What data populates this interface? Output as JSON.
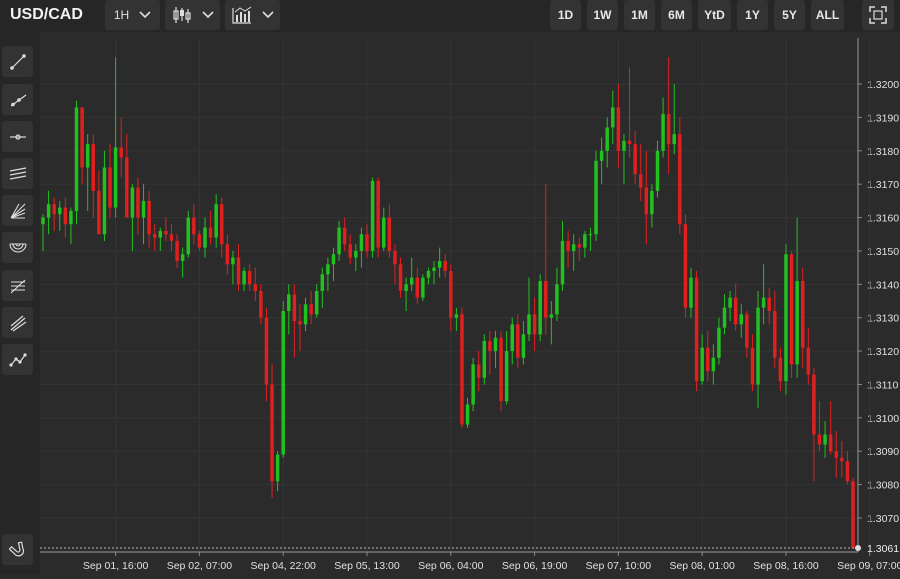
{
  "header": {
    "symbol": "USD/CAD",
    "interval": "1H",
    "ranges": [
      "1D",
      "1W",
      "1M",
      "6M",
      "YtD",
      "1Y",
      "5Y",
      "ALL"
    ]
  },
  "icons": {
    "chart_type": "candlestick-icon",
    "indicators": "indicators-icon",
    "fullscreen": "fullscreen-icon",
    "tools": [
      "trend-line-icon",
      "ray-line-icon",
      "horizontal-line-icon",
      "parallel-channel-icon",
      "fib-fan-icon",
      "fib-arc-icon",
      "fib-retracement-icon",
      "pitchfork-icon",
      "polyline-icon",
      "magnet-icon"
    ]
  },
  "colors": {
    "up": "#21c21f",
    "down": "#e0201f",
    "background": "#2b2b2b",
    "grid": "#353535"
  },
  "chart_data": {
    "type": "candlestick",
    "ylim": [
      1.3061,
      1.3212
    ],
    "y_ticks": [
      "1.3200",
      "1.3190",
      "1.3180",
      "1.3170",
      "1.3160",
      "1.3150",
      "1.3140",
      "1.3130",
      "1.3120",
      "1.3110",
      "1.3100",
      "1.3090",
      "1.3080",
      "1.3070"
    ],
    "current_price": "1.3061",
    "x_ticks": [
      {
        "label": "Sep 01, 16:00",
        "index": 13
      },
      {
        "label": "Sep 02, 07:00",
        "index": 28
      },
      {
        "label": "Sep 04, 22:00",
        "index": 43
      },
      {
        "label": "Sep 05, 13:00",
        "index": 58
      },
      {
        "label": "Sep 06, 04:00",
        "index": 73
      },
      {
        "label": "Sep 06, 19:00",
        "index": 88
      },
      {
        "label": "Sep 07, 10:00",
        "index": 103
      },
      {
        "label": "Sep 08, 01:00",
        "index": 118
      },
      {
        "label": "Sep 08, 16:00",
        "index": 133
      },
      {
        "label": "Sep 09, 07:00",
        "index": 148
      }
    ],
    "candles": [
      [
        1.3158,
        1.3161,
        1.315,
        1.316
      ],
      [
        1.316,
        1.3168,
        1.3155,
        1.3164
      ],
      [
        1.3164,
        1.3166,
        1.3156,
        1.3161
      ],
      [
        1.3161,
        1.3165,
        1.3156,
        1.3163
      ],
      [
        1.3163,
        1.3166,
        1.3154,
        1.3158
      ],
      [
        1.3158,
        1.3163,
        1.3152,
        1.3162
      ],
      [
        1.3162,
        1.3195,
        1.3158,
        1.3193
      ],
      [
        1.3193,
        1.3193,
        1.317,
        1.3175
      ],
      [
        1.3175,
        1.3185,
        1.3162,
        1.3182
      ],
      [
        1.3182,
        1.3185,
        1.316,
        1.3168
      ],
      [
        1.3168,
        1.3174,
        1.3155,
        1.3155
      ],
      [
        1.3155,
        1.318,
        1.3153,
        1.3175
      ],
      [
        1.3175,
        1.3182,
        1.316,
        1.3163
      ],
      [
        1.3163,
        1.3208,
        1.316,
        1.3181
      ],
      [
        1.3181,
        1.319,
        1.3172,
        1.3178
      ],
      [
        1.3178,
        1.3185,
        1.3165,
        1.316
      ],
      [
        1.316,
        1.317,
        1.315,
        1.3169
      ],
      [
        1.3169,
        1.3172,
        1.3155,
        1.316
      ],
      [
        1.316,
        1.317,
        1.3152,
        1.3165
      ],
      [
        1.3165,
        1.3168,
        1.3151,
        1.3155
      ],
      [
        1.3155,
        1.3158,
        1.315,
        1.3154
      ],
      [
        1.3154,
        1.3157,
        1.315,
        1.3156
      ],
      [
        1.3156,
        1.316,
        1.3153,
        1.3155
      ],
      [
        1.3155,
        1.3158,
        1.315,
        1.3153
      ],
      [
        1.3153,
        1.3155,
        1.3145,
        1.3147
      ],
      [
        1.3147,
        1.3151,
        1.3142,
        1.3149
      ],
      [
        1.3149,
        1.3162,
        1.3148,
        1.316
      ],
      [
        1.316,
        1.3164,
        1.3152,
        1.3155
      ],
      [
        1.3155,
        1.3156,
        1.315,
        1.3151
      ],
      [
        1.3151,
        1.316,
        1.3148,
        1.3157
      ],
      [
        1.3157,
        1.3162,
        1.3152,
        1.3154
      ],
      [
        1.3154,
        1.3167,
        1.3151,
        1.3164
      ],
      [
        1.3164,
        1.3166,
        1.3148,
        1.3152
      ],
      [
        1.3152,
        1.3155,
        1.3143,
        1.3146
      ],
      [
        1.3146,
        1.315,
        1.314,
        1.3148
      ],
      [
        1.3148,
        1.3152,
        1.3138,
        1.314
      ],
      [
        1.314,
        1.3145,
        1.3138,
        1.3144
      ],
      [
        1.3144,
        1.3146,
        1.3138,
        1.314
      ],
      [
        1.314,
        1.3145,
        1.3135,
        1.3138
      ],
      [
        1.3138,
        1.314,
        1.3128,
        1.313
      ],
      [
        1.313,
        1.3133,
        1.3105,
        1.311
      ],
      [
        1.311,
        1.3116,
        1.3076,
        1.3081
      ],
      [
        1.3081,
        1.309,
        1.3078,
        1.3089
      ],
      [
        1.3089,
        1.3135,
        1.3088,
        1.3132
      ],
      [
        1.3132,
        1.314,
        1.3125,
        1.3137
      ],
      [
        1.3137,
        1.314,
        1.3118,
        1.3129
      ],
      [
        1.3129,
        1.3134,
        1.312,
        1.3128
      ],
      [
        1.3128,
        1.3136,
        1.3126,
        1.3134
      ],
      [
        1.3134,
        1.3138,
        1.3128,
        1.3131
      ],
      [
        1.3131,
        1.314,
        1.313,
        1.3138
      ],
      [
        1.3138,
        1.3145,
        1.3133,
        1.3143
      ],
      [
        1.3143,
        1.3148,
        1.3138,
        1.3146
      ],
      [
        1.3146,
        1.3151,
        1.3141,
        1.3149
      ],
      [
        1.3149,
        1.3159,
        1.3147,
        1.3157
      ],
      [
        1.3157,
        1.316,
        1.315,
        1.3152
      ],
      [
        1.3152,
        1.3155,
        1.3146,
        1.3148
      ],
      [
        1.3148,
        1.3152,
        1.3144,
        1.315
      ],
      [
        1.315,
        1.3157,
        1.3145,
        1.3155
      ],
      [
        1.3155,
        1.3158,
        1.3148,
        1.315
      ],
      [
        1.315,
        1.3172,
        1.3148,
        1.3171
      ],
      [
        1.3171,
        1.3172,
        1.3148,
        1.3151
      ],
      [
        1.3151,
        1.3163,
        1.315,
        1.316
      ],
      [
        1.316,
        1.3164,
        1.3148,
        1.315
      ],
      [
        1.315,
        1.3152,
        1.314,
        1.3146
      ],
      [
        1.3146,
        1.3148,
        1.3136,
        1.3138
      ],
      [
        1.3138,
        1.3142,
        1.3132,
        1.314
      ],
      [
        1.314,
        1.3148,
        1.3138,
        1.3142
      ],
      [
        1.3142,
        1.3145,
        1.3134,
        1.3136
      ],
      [
        1.3136,
        1.3143,
        1.3135,
        1.3142
      ],
      [
        1.3142,
        1.3145,
        1.314,
        1.3144
      ],
      [
        1.3144,
        1.3147,
        1.314,
        1.3145
      ],
      [
        1.3145,
        1.3151,
        1.3142,
        1.3147
      ],
      [
        1.3147,
        1.3149,
        1.3142,
        1.3144
      ],
      [
        1.3144,
        1.3146,
        1.3126,
        1.313
      ],
      [
        1.313,
        1.3133,
        1.3126,
        1.3131
      ],
      [
        1.3131,
        1.3133,
        1.3097,
        1.3098
      ],
      [
        1.3098,
        1.3106,
        1.3097,
        1.3104
      ],
      [
        1.3104,
        1.3118,
        1.3102,
        1.3116
      ],
      [
        1.3116,
        1.312,
        1.3108,
        1.3112
      ],
      [
        1.3112,
        1.3125,
        1.311,
        1.3123
      ],
      [
        1.3123,
        1.3126,
        1.3113,
        1.312
      ],
      [
        1.312,
        1.3126,
        1.3115,
        1.3124
      ],
      [
        1.3124,
        1.3126,
        1.3102,
        1.3105
      ],
      [
        1.3105,
        1.3126,
        1.3104,
        1.312
      ],
      [
        1.312,
        1.313,
        1.3116,
        1.3128
      ],
      [
        1.3128,
        1.3131,
        1.3115,
        1.3118
      ],
      [
        1.3118,
        1.3129,
        1.3116,
        1.3125
      ],
      [
        1.3125,
        1.3142,
        1.3123,
        1.3131
      ],
      [
        1.3131,
        1.3136,
        1.312,
        1.3125
      ],
      [
        1.3125,
        1.3143,
        1.3123,
        1.3141
      ],
      [
        1.3141,
        1.317,
        1.3125,
        1.313
      ],
      [
        1.313,
        1.3135,
        1.3122,
        1.3131
      ],
      [
        1.3131,
        1.3145,
        1.3129,
        1.314
      ],
      [
        1.314,
        1.3159,
        1.3138,
        1.3153
      ],
      [
        1.3153,
        1.3156,
        1.3145,
        1.315
      ],
      [
        1.315,
        1.3155,
        1.3144,
        1.3152
      ],
      [
        1.3152,
        1.3154,
        1.3147,
        1.3151
      ],
      [
        1.3151,
        1.3156,
        1.3148,
        1.3155
      ],
      [
        1.3155,
        1.3157,
        1.315,
        1.3155
      ],
      [
        1.3155,
        1.318,
        1.3153,
        1.3177
      ],
      [
        1.3177,
        1.3184,
        1.317,
        1.318
      ],
      [
        1.318,
        1.319,
        1.3175,
        1.3187
      ],
      [
        1.3187,
        1.3198,
        1.3182,
        1.3193
      ],
      [
        1.3193,
        1.32,
        1.3175,
        1.318
      ],
      [
        1.318,
        1.3185,
        1.317,
        1.3183
      ],
      [
        1.3183,
        1.3205,
        1.3178,
        1.3182
      ],
      [
        1.3182,
        1.3186,
        1.317,
        1.3173
      ],
      [
        1.3173,
        1.3182,
        1.3165,
        1.3169
      ],
      [
        1.3169,
        1.318,
        1.3152,
        1.3161
      ],
      [
        1.3161,
        1.317,
        1.3157,
        1.3168
      ],
      [
        1.3168,
        1.3183,
        1.3166,
        1.318
      ],
      [
        1.318,
        1.3196,
        1.3178,
        1.3191
      ],
      [
        1.3191,
        1.3208,
        1.3173,
        1.3182
      ],
      [
        1.3182,
        1.32,
        1.3179,
        1.3185
      ],
      [
        1.3185,
        1.319,
        1.3155,
        1.3158
      ],
      [
        1.3158,
        1.3161,
        1.313,
        1.3133
      ],
      [
        1.3133,
        1.3145,
        1.313,
        1.3142
      ],
      [
        1.3142,
        1.3144,
        1.3108,
        1.3111
      ],
      [
        1.3111,
        1.3125,
        1.311,
        1.3121
      ],
      [
        1.3121,
        1.3126,
        1.3111,
        1.3114
      ],
      [
        1.3114,
        1.3122,
        1.311,
        1.3118
      ],
      [
        1.3118,
        1.313,
        1.3116,
        1.3127
      ],
      [
        1.3127,
        1.3137,
        1.3125,
        1.3133
      ],
      [
        1.3133,
        1.3138,
        1.3129,
        1.3136
      ],
      [
        1.3136,
        1.314,
        1.3126,
        1.3128
      ],
      [
        1.3128,
        1.3134,
        1.3124,
        1.3131
      ],
      [
        1.3131,
        1.3132,
        1.3118,
        1.3121
      ],
      [
        1.3121,
        1.3125,
        1.3108,
        1.311
      ],
      [
        1.311,
        1.3138,
        1.3103,
        1.3133
      ],
      [
        1.3133,
        1.3146,
        1.3128,
        1.3136
      ],
      [
        1.3136,
        1.3139,
        1.3128,
        1.3132
      ],
      [
        1.3132,
        1.3138,
        1.3115,
        1.3118
      ],
      [
        1.3118,
        1.3121,
        1.3108,
        1.3111
      ],
      [
        1.3111,
        1.3152,
        1.3107,
        1.3149
      ],
      [
        1.3149,
        1.315,
        1.3112,
        1.3116
      ],
      [
        1.3116,
        1.316,
        1.3112,
        1.3141
      ],
      [
        1.3141,
        1.3145,
        1.3115,
        1.3121
      ],
      [
        1.3121,
        1.3127,
        1.311,
        1.3113
      ],
      [
        1.3113,
        1.3115,
        1.3081,
        1.3095
      ],
      [
        1.3095,
        1.3105,
        1.309,
        1.3092
      ],
      [
        1.3092,
        1.3099,
        1.3088,
        1.3095
      ],
      [
        1.3095,
        1.3105,
        1.3089,
        1.309
      ],
      [
        1.309,
        1.3096,
        1.3082,
        1.3088
      ],
      [
        1.3088,
        1.3093,
        1.3082,
        1.3087
      ],
      [
        1.3087,
        1.309,
        1.308,
        1.3081
      ],
      [
        1.3081,
        1.3082,
        1.3061,
        1.3061
      ]
    ]
  },
  "footer": {
    "magnet": "magnet-icon"
  }
}
